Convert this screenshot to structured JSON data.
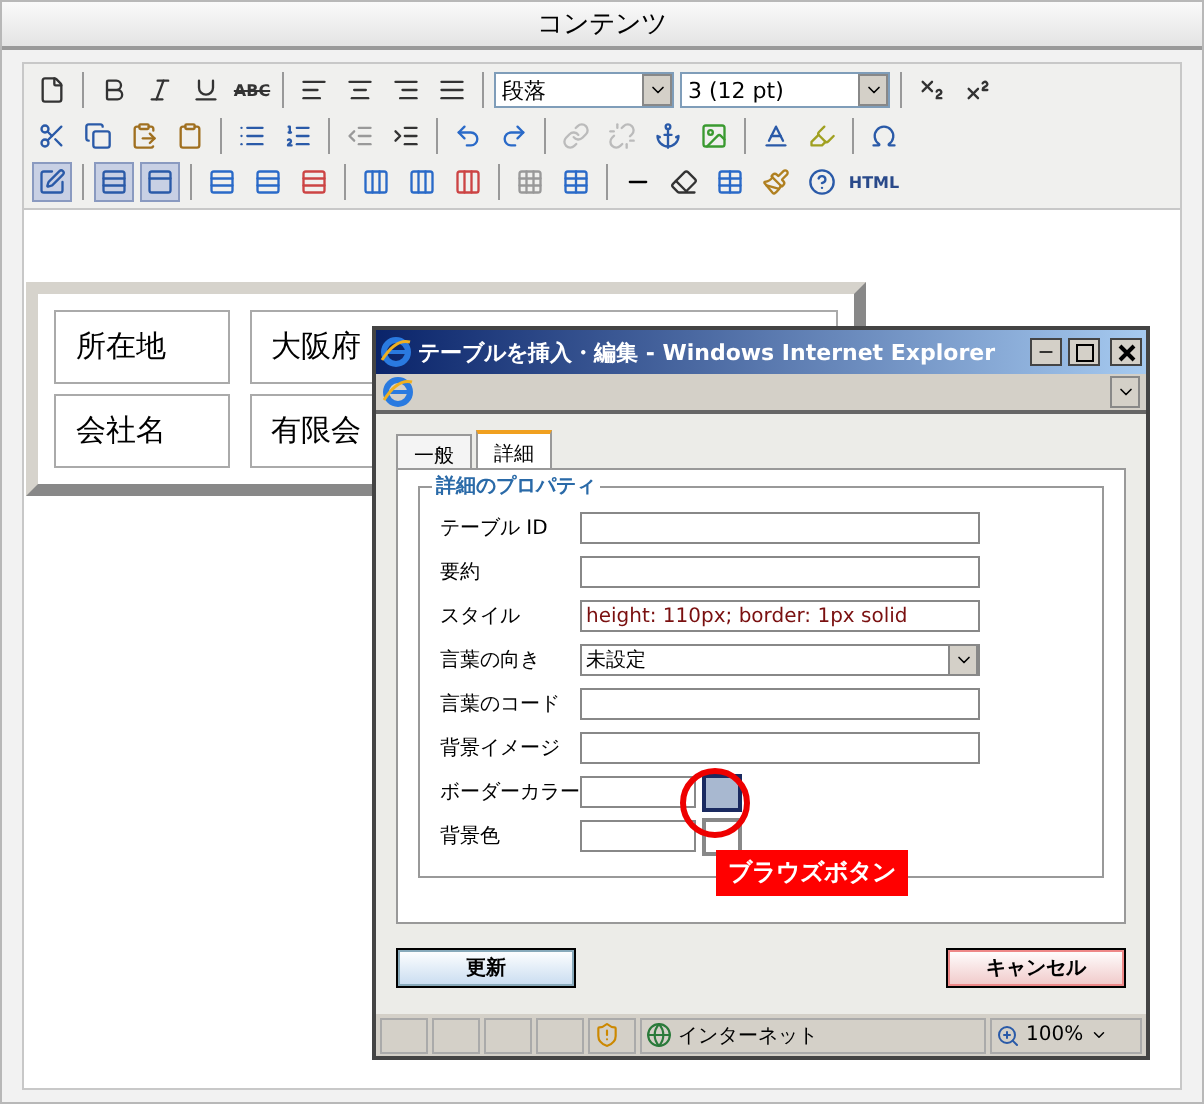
{
  "header": {
    "title": "コンテンツ"
  },
  "toolbar": {
    "format_select": "段落",
    "size_select": "3 (12 pt)",
    "strikethrough_label": "ABC",
    "html_label": "HTML",
    "toggles": [
      {
        "on": true
      },
      {
        "on": true
      },
      {
        "on": true
      }
    ]
  },
  "table": {
    "rows": [
      [
        "所在地",
        "大阪府"
      ],
      [
        "会社名",
        "有限会"
      ]
    ]
  },
  "dialog": {
    "title": "テーブルを挿入・編集 - Windows Internet Explorer",
    "tabs": [
      {
        "label": "一般",
        "selected": false
      },
      {
        "label": "詳細",
        "selected": true
      }
    ],
    "fieldset_title": "詳細のプロパティ",
    "fields": [
      {
        "kind": "text",
        "label": "テーブル ID"
      },
      {
        "kind": "text",
        "label": "要約"
      },
      {
        "kind": "text",
        "label": "スタイル",
        "value": "height: 110px; border: 1px solid"
      },
      {
        "kind": "select",
        "label": "言葉の向き",
        "value": "未設定"
      },
      {
        "kind": "text",
        "label": "言葉のコード"
      },
      {
        "kind": "text",
        "label": "背景イメージ"
      },
      {
        "kind": "color",
        "label": "ボーダーカラー"
      },
      {
        "kind": "color",
        "label": "背景色"
      }
    ],
    "buttons": [
      {
        "label": "更新",
        "kind": "primary"
      },
      {
        "label": "キャンセル",
        "kind": "cancel"
      }
    ],
    "status": {
      "zone": "インターネット",
      "zoom": "100%"
    }
  },
  "annotation": {
    "label": "ブラウズボタン"
  }
}
